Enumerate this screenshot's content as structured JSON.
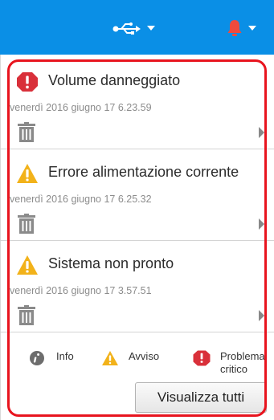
{
  "toolbar": {
    "usb_icon": "usb-icon",
    "bell_icon": "bell-icon"
  },
  "notifications": [
    {
      "severity": "critical",
      "icon": "critical-octagon-icon",
      "title": "Volume danneggiato",
      "timestamp": "venerdì 2016 giugno 17 6.23.59"
    },
    {
      "severity": "warning",
      "icon": "warning-triangle-icon",
      "title": "Errore alimentazione corrente",
      "timestamp": "venerdì 2016 giugno 17 6.25.32"
    },
    {
      "severity": "warning",
      "icon": "warning-triangle-icon",
      "title": "Sistema non pronto",
      "timestamp": "venerdì 2016 giugno 17 3.57.51"
    }
  ],
  "legend": {
    "info": "Info",
    "warning": "Avviso",
    "critical_line1": "Problema",
    "critical_line2": "critico"
  },
  "view_all_label": "Visualizza tutti",
  "colors": {
    "topbar": "#0a8fe6",
    "critical": "#d9303a",
    "warning": "#f2b21a",
    "info": "#6d6d6d",
    "highlight": "#e8141e"
  }
}
